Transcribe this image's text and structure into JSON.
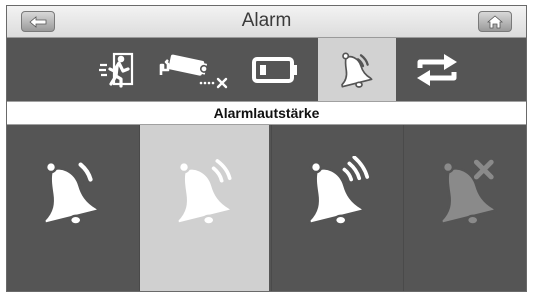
{
  "header": {
    "title": "Alarm",
    "back_icon": "back-arrow-icon",
    "home_icon": "home-icon"
  },
  "tabs": [
    {
      "icon": "running-person-icon",
      "active": false
    },
    {
      "icon": "camera-disconnected-icon",
      "active": false
    },
    {
      "icon": "battery-low-icon",
      "active": false
    },
    {
      "icon": "bell-icon",
      "active": true
    },
    {
      "icon": "repeat-arrows-icon",
      "active": false
    }
  ],
  "section": {
    "label": "Alarmlautstärke"
  },
  "volume_options": [
    {
      "icon": "bell-volume-low-icon",
      "selected": false
    },
    {
      "icon": "bell-volume-medium-icon",
      "selected": true
    },
    {
      "icon": "bell-volume-high-icon",
      "selected": false
    },
    {
      "icon": "bell-muted-icon",
      "selected": false
    }
  ],
  "colors": {
    "bar_background": "#555555",
    "selected_background": "#d0d0d0",
    "icon_white": "#ffffff",
    "icon_disabled": "#8a8a8a"
  }
}
